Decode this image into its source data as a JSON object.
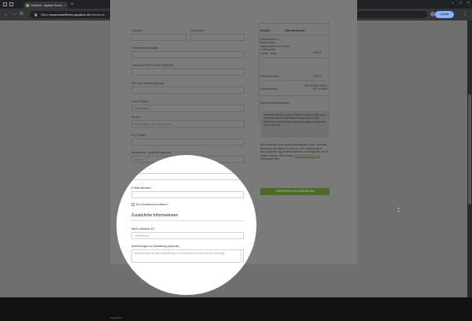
{
  "browser": {
    "tab_title": "Checkout – Applikon für das Ge...",
    "tab_close": "×",
    "new_tab": "+",
    "url_prefix": "https://",
    "url_host": "www.anselfbrew-applikon.de",
    "url_path": "/checkout/",
    "update_label": "Update",
    "menu": "⋮",
    "window": {
      "minimize": "–",
      "maximize": "□",
      "close": "×"
    },
    "nav": {
      "back": "←",
      "forward": "→",
      "reload": "↻"
    },
    "icons": {
      "lock": "lock-icon"
    }
  },
  "billing": {
    "first_name_label": "Vorname *",
    "last_name_label": "Nachname *",
    "company_label": "Firmenname (optional)",
    "company_reg_label": "Company ID/EUI Number (optional)",
    "vat_label": "VAT (Tax Number (optional)",
    "country_label": "Land / Region *",
    "country_value": "Deutschland",
    "street_label": "Straße *",
    "street_placeholder": "Straßenname und Hausnummer",
    "zip_label": "PLZ / Stadt *",
    "state_label": "Bundesland / Landkreis (optional)",
    "state_value": "Bayern",
    "city_label": "Ortschaft *",
    "email_label": "E-Mail-Adresse *",
    "create_account_label": "Ein Kundenkonto eröffnen?",
    "additional_heading": "Zusätzliche Informationen",
    "vat2_label": "MwSt.-Adresse ID *",
    "vat2_value": "0000000000",
    "notes_label": "Anmerkungen zur Bestellung (optional)",
    "notes_placeholder": "Anmerkungen zu deiner Bestellung, z.B. besondere Hinweise für die Lieferung."
  },
  "order": {
    "col_product": "Produkt",
    "col_subtotal": "Zwischensumme",
    "item_lines": [
      "Getreidemühle 3",
      "Ergänzungen:",
      "Warenkorb Einzel Dresden",
      "1 Windschutz",
      "Kraute – Hase"
    ],
    "item_price": "49,00 €",
    "subtotal_label": "Zwischensumme",
    "subtotal_value": "49,00 €",
    "total_label": "Gesamtsumme",
    "total_value": "49,00 € (inkl. MwSt.)",
    "total_note": "inkl. Versand",
    "payment_heading": "Direkte Banküberweisung",
    "payment_notice": "Überweise direkt an unsere Bankverbindung. Bitte nutze die Bestellnummer als Verwendungszweck. Deine Bestellung wird erst nach Zahlungseingang auf unserem Konto versandt.",
    "privacy_text": "Wir verwenden deine personenbezogenen Daten, um deine Bestellung durchführen zu können, eine möglichst gute Benutzererfahrung auf dieser Website zu ermöglichen und für weitere Zwecke, die in unserer",
    "privacy_link": "Datenschutzerklärung",
    "privacy_tail": "beschrieben sind.",
    "order_button": "KOSTENPFLICHTIG BESTELLEN"
  },
  "footer": {
    "brand": "Applikon"
  }
}
